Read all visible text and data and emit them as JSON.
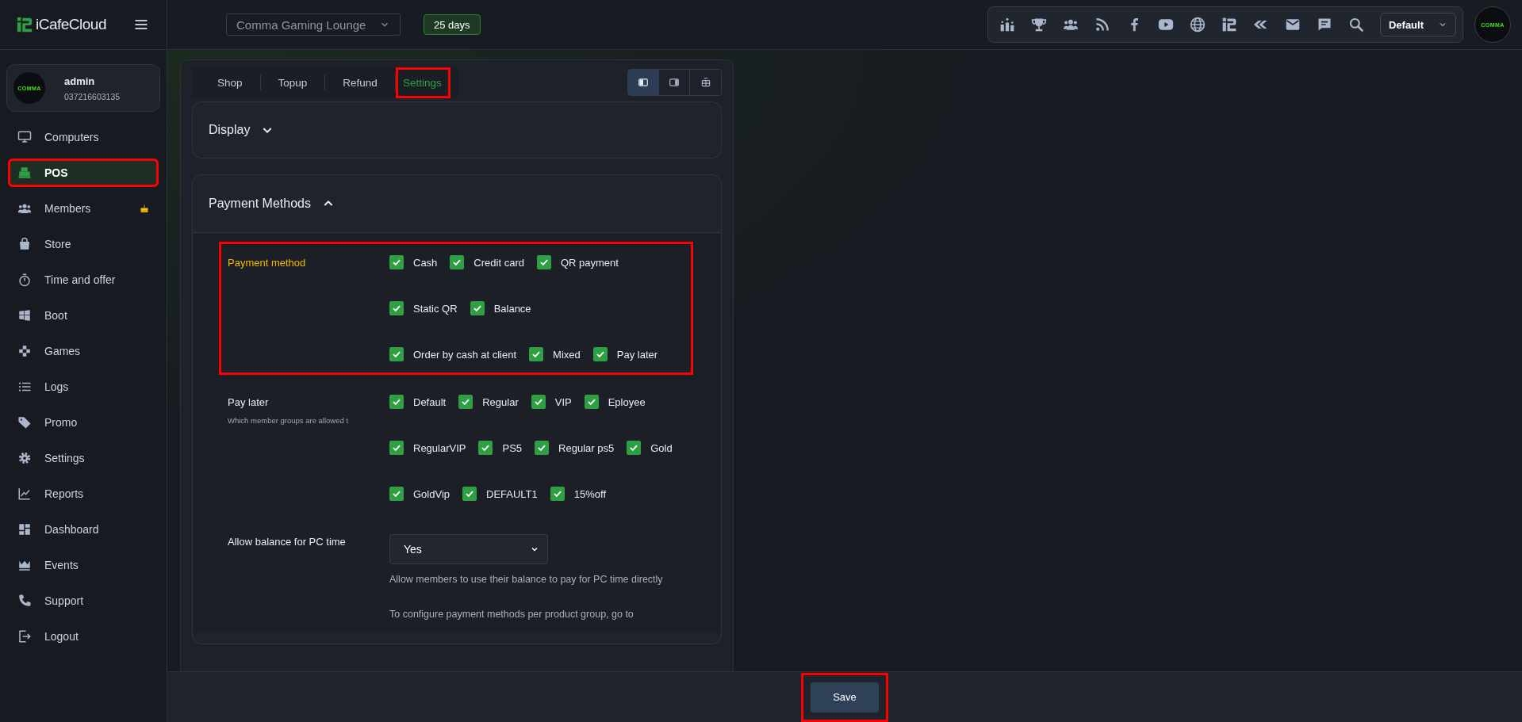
{
  "brand": {
    "name": "iCafeCloud"
  },
  "user": {
    "name": "admin",
    "phone": "037216603135",
    "logo": "COMMA"
  },
  "nav": [
    {
      "label": "Computers",
      "selected": false,
      "highlighted": false,
      "alert": false
    },
    {
      "label": "POS",
      "selected": true,
      "highlighted": true,
      "alert": false
    },
    {
      "label": "Members",
      "selected": false,
      "highlighted": false,
      "alert": true
    },
    {
      "label": "Store",
      "selected": false,
      "highlighted": false,
      "alert": false
    },
    {
      "label": "Time and offer",
      "selected": false,
      "highlighted": false,
      "alert": false
    },
    {
      "label": "Boot",
      "selected": false,
      "highlighted": false,
      "alert": false
    },
    {
      "label": "Games",
      "selected": false,
      "highlighted": false,
      "alert": false
    },
    {
      "label": "Logs",
      "selected": false,
      "highlighted": false,
      "alert": false
    },
    {
      "label": "Promo",
      "selected": false,
      "highlighted": false,
      "alert": false
    },
    {
      "label": "Settings",
      "selected": false,
      "highlighted": false,
      "alert": false
    },
    {
      "label": "Reports",
      "selected": false,
      "highlighted": false,
      "alert": false
    },
    {
      "label": "Dashboard",
      "selected": false,
      "highlighted": false,
      "alert": false
    },
    {
      "label": "Events",
      "selected": false,
      "highlighted": false,
      "alert": false
    },
    {
      "label": "Support",
      "selected": false,
      "highlighted": false,
      "alert": false
    },
    {
      "label": "Logout",
      "selected": false,
      "highlighted": false,
      "alert": false
    }
  ],
  "topbar": {
    "store_select": "Comma Gaming Lounge",
    "days_badge": "25 days",
    "profile_select": "Default",
    "avatar_logo": "COMMA"
  },
  "tabs": [
    {
      "label": "Shop",
      "selected": false,
      "highlighted": false
    },
    {
      "label": "Topup",
      "selected": false,
      "highlighted": false
    },
    {
      "label": "Refund",
      "selected": false,
      "highlighted": false
    },
    {
      "label": "Settings",
      "selected": true,
      "highlighted": true
    }
  ],
  "layout_buttons": [
    {
      "selected": true
    },
    {
      "selected": false
    },
    {
      "selected": false
    }
  ],
  "display_section": {
    "title": "Display",
    "expanded": false
  },
  "payment_section": {
    "title": "Payment Methods",
    "expanded": true
  },
  "payment_method": {
    "label": "Payment method",
    "highlighted": true,
    "rows": [
      {
        "options": [
          {
            "label": "Cash",
            "checked": true
          },
          {
            "label": "Credit card",
            "checked": true
          },
          {
            "label": "QR payment",
            "checked": true
          }
        ]
      },
      {
        "options": [
          {
            "label": "Static QR",
            "checked": true
          },
          {
            "label": "Balance",
            "checked": true
          }
        ]
      },
      {
        "options": [
          {
            "label": "Order by cash at client",
            "checked": true
          },
          {
            "label": "Mixed",
            "checked": true
          },
          {
            "label": "Pay later",
            "checked": true
          }
        ]
      }
    ]
  },
  "pay_later": {
    "label": "Pay later",
    "hint": "Which member groups are allowed t",
    "rows": [
      {
        "options": [
          {
            "label": "Default",
            "checked": true
          },
          {
            "label": "Regular",
            "checked": true
          },
          {
            "label": "VIP",
            "checked": true
          },
          {
            "label": "Eployee",
            "checked": true
          }
        ]
      },
      {
        "options": [
          {
            "label": "RegularVIP",
            "checked": true
          },
          {
            "label": "PS5",
            "checked": true
          },
          {
            "label": "Regular ps5",
            "checked": true
          },
          {
            "label": "Gold",
            "checked": true
          }
        ]
      },
      {
        "options": [
          {
            "label": "GoldVip",
            "checked": true
          },
          {
            "label": "DEFAULT1",
            "checked": true
          },
          {
            "label": "15%off",
            "checked": true
          }
        ]
      }
    ]
  },
  "allow_balance": {
    "label": "Allow balance for PC time",
    "value": "Yes",
    "help": "Allow members to use their balance to pay for PC time directly",
    "note": "To configure payment methods per product group, go to"
  },
  "save_button": {
    "label": "Save",
    "highlighted": true
  }
}
